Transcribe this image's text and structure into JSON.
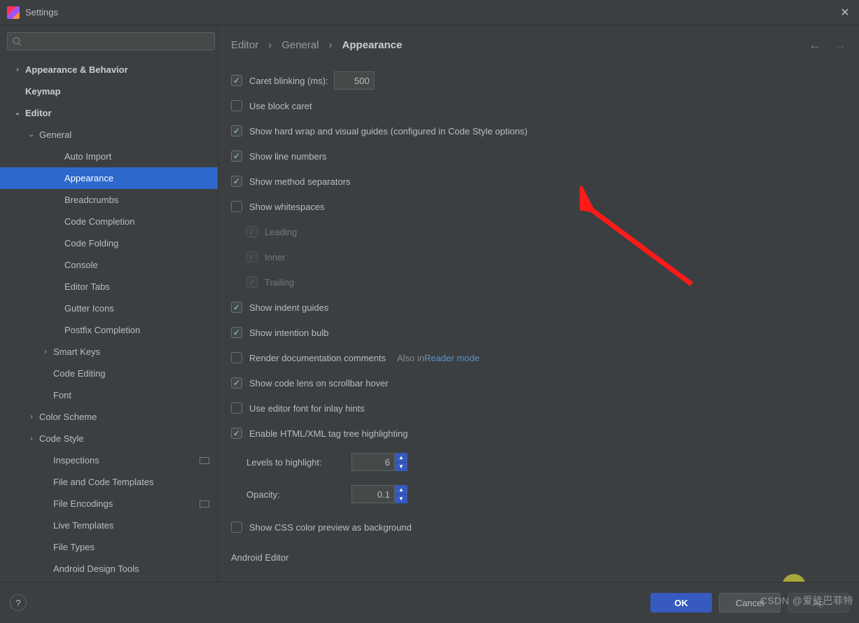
{
  "window": {
    "title": "Settings"
  },
  "sidebar": {
    "search_placeholder": "",
    "items": [
      {
        "label": "Appearance & Behavior",
        "bold": true,
        "lvl": 0,
        "chev": "›"
      },
      {
        "label": "Keymap",
        "bold": true,
        "lvl": 0,
        "chev": ""
      },
      {
        "label": "Editor",
        "bold": true,
        "lvl": 0,
        "chev": "⌄"
      },
      {
        "label": "General",
        "bold": false,
        "lvl": 1,
        "chev": "⌄"
      },
      {
        "label": "Auto Import",
        "bold": false,
        "lvl": 3,
        "chev": ""
      },
      {
        "label": "Appearance",
        "bold": false,
        "lvl": 3,
        "chev": "",
        "selected": true
      },
      {
        "label": "Breadcrumbs",
        "bold": false,
        "lvl": 3,
        "chev": ""
      },
      {
        "label": "Code Completion",
        "bold": false,
        "lvl": 3,
        "chev": ""
      },
      {
        "label": "Code Folding",
        "bold": false,
        "lvl": 3,
        "chev": ""
      },
      {
        "label": "Console",
        "bold": false,
        "lvl": 3,
        "chev": ""
      },
      {
        "label": "Editor Tabs",
        "bold": false,
        "lvl": 3,
        "chev": ""
      },
      {
        "label": "Gutter Icons",
        "bold": false,
        "lvl": 3,
        "chev": ""
      },
      {
        "label": "Postfix Completion",
        "bold": false,
        "lvl": 3,
        "chev": ""
      },
      {
        "label": "Smart Keys",
        "bold": false,
        "lvl": 2,
        "chev": "›"
      },
      {
        "label": "Code Editing",
        "bold": false,
        "lvl": 2,
        "chev": ""
      },
      {
        "label": "Font",
        "bold": false,
        "lvl": 2,
        "chev": ""
      },
      {
        "label": "Color Scheme",
        "bold": false,
        "lvl": 1,
        "chev": "›"
      },
      {
        "label": "Code Style",
        "bold": false,
        "lvl": 1,
        "chev": "›"
      },
      {
        "label": "Inspections",
        "bold": false,
        "lvl": 2,
        "chev": "",
        "badge": true
      },
      {
        "label": "File and Code Templates",
        "bold": false,
        "lvl": 2,
        "chev": ""
      },
      {
        "label": "File Encodings",
        "bold": false,
        "lvl": 2,
        "chev": "",
        "badge": true
      },
      {
        "label": "Live Templates",
        "bold": false,
        "lvl": 2,
        "chev": ""
      },
      {
        "label": "File Types",
        "bold": false,
        "lvl": 2,
        "chev": ""
      },
      {
        "label": "Android Design Tools",
        "bold": false,
        "lvl": 2,
        "chev": ""
      }
    ]
  },
  "breadcrumb": {
    "a": "Editor",
    "b": "General",
    "c": "Appearance"
  },
  "options": {
    "caret_blinking": {
      "label": "Caret blinking (ms):",
      "checked": true,
      "value": "500"
    },
    "block_caret": {
      "label": "Use block caret",
      "checked": false
    },
    "hard_wrap": {
      "label": "Show hard wrap and visual guides (configured in Code Style options)",
      "checked": true
    },
    "line_numbers": {
      "label": "Show line numbers",
      "checked": true
    },
    "method_sep": {
      "label": "Show method separators",
      "checked": true
    },
    "whitespaces": {
      "label": "Show whitespaces",
      "checked": false
    },
    "ws_leading": {
      "label": "Leading",
      "checked": true
    },
    "ws_inner": {
      "label": "Inner",
      "checked": true
    },
    "ws_trailing": {
      "label": "Trailing",
      "checked": true
    },
    "indent_guides": {
      "label": "Show indent guides",
      "checked": true
    },
    "intention_bulb": {
      "label": "Show intention bulb",
      "checked": true
    },
    "render_doc": {
      "label": "Render documentation comments",
      "checked": false,
      "also": "Also in ",
      "link": "Reader mode"
    },
    "code_lens": {
      "label": "Show code lens on scrollbar hover",
      "checked": true
    },
    "inlay_font": {
      "label": "Use editor font for inlay hints",
      "checked": false
    },
    "tag_tree": {
      "label": "Enable HTML/XML tag tree highlighting",
      "checked": true
    },
    "levels": {
      "label": "Levels to highlight:",
      "value": "6"
    },
    "opacity": {
      "label": "Opacity:",
      "value": "0.1"
    },
    "css_preview": {
      "label": "Show CSS color preview as background",
      "checked": false
    },
    "android_hdr": "Android Editor"
  },
  "footer": {
    "ok": "OK",
    "cancel": "Cancel",
    "apply": "Ap"
  },
  "watermark": "CSDN @爱徒巴菲特"
}
